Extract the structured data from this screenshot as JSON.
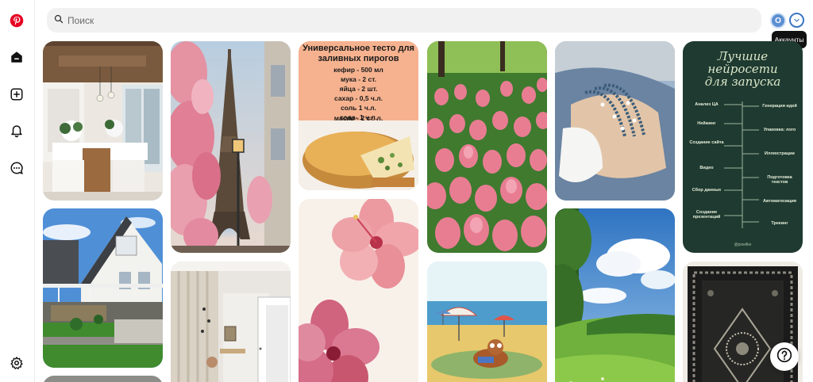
{
  "search": {
    "placeholder": "Поиск"
  },
  "account": {
    "avatar_initial": "O",
    "tooltip": "Аккаунты"
  },
  "pins": {
    "recipe": {
      "title_line1": "Универсальное тесто для",
      "title_line2": "заливных пирогов",
      "ingredients": [
        "кефир - 500 мл",
        "мука - 2 ст.",
        "яйца - 2 шт.",
        "сахар - 0,5 ч.л.",
        "соль 1 ч.л.",
        "сода- 1 ч.л.",
        "масло - 2 ст. л."
      ]
    },
    "ai_tools": {
      "title_line1": "Лучшие",
      "title_line2": "нейросети",
      "title_line3": "для запуска",
      "left_items": [
        "Анализ ЦА",
        "Нейминг",
        "Создание сайта",
        "Видео",
        "Сбор данных",
        "Создание презентаций"
      ],
      "right_items": [
        "Генерация идей",
        "Упаковка: лого",
        "Иллюстрации",
        "Подготовка текстов",
        "Автоматизация",
        "Трекинг"
      ],
      "footer": "@pixelike"
    }
  },
  "colors": {
    "brand": "#e60023",
    "search_bg": "#f1f1f1",
    "ai_bg": "#1f3a31"
  }
}
